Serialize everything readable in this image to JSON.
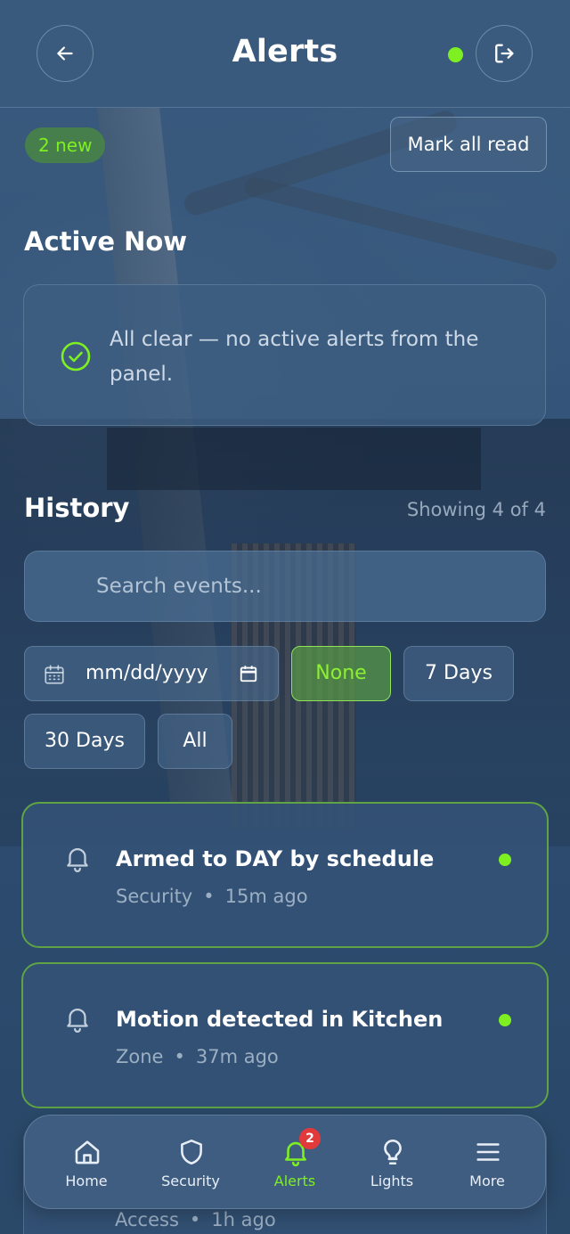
{
  "header": {
    "title": "Alerts",
    "back_icon": "arrow-left-icon",
    "logout_icon": "logout-icon",
    "status_color": "#7ef022"
  },
  "badges": {
    "new_count_label": "2 new",
    "mark_all_read": "Mark all read"
  },
  "active": {
    "title": "Active Now",
    "message": "All clear — no active alerts from the panel."
  },
  "history": {
    "title": "History",
    "showing": "Showing 4 of 4",
    "search_placeholder": "Search events...",
    "date_placeholder": "mm/dd/yyyy",
    "filters": {
      "none": "None",
      "seven_days": "7 Days",
      "thirty_days": "30 Days",
      "all": "All"
    },
    "selected_filter": "None",
    "events": [
      {
        "title": "Armed to DAY by schedule",
        "category": "Security",
        "time": "15m ago",
        "unread": true
      },
      {
        "title": "Motion detected in Kitchen",
        "category": "Zone",
        "time": "37m ago",
        "unread": true
      },
      {
        "title": "",
        "category": "Access",
        "time": "1h ago",
        "unread": false
      }
    ],
    "separator": "•"
  },
  "nav": {
    "items": [
      {
        "label": "Home",
        "icon": "home-icon"
      },
      {
        "label": "Security",
        "icon": "shield-icon"
      },
      {
        "label": "Alerts",
        "icon": "bell-icon",
        "badge": "2",
        "active": true
      },
      {
        "label": "Lights",
        "icon": "lightbulb-icon"
      },
      {
        "label": "More",
        "icon": "menu-icon"
      }
    ]
  },
  "colors": {
    "accent_green": "#7ef022",
    "card_border_unread": "#5fa345",
    "badge_red": "#e23a3a"
  }
}
